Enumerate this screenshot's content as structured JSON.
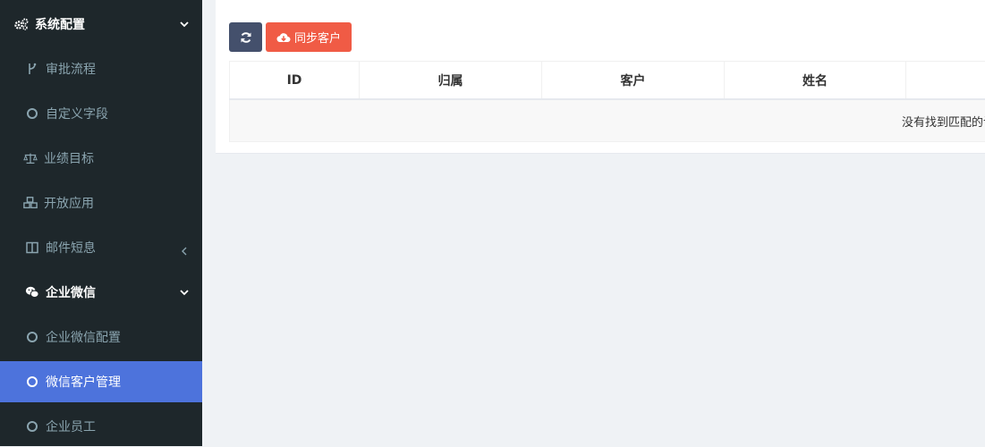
{
  "sidebar": {
    "items": [
      {
        "label": "系统配置",
        "icon": "gears-icon",
        "type": "group",
        "arrow": "chevron-down"
      },
      {
        "label": "审批流程",
        "icon": "fork-icon",
        "type": "child"
      },
      {
        "label": "自定义字段",
        "icon": "circle-icon",
        "type": "child"
      },
      {
        "label": "业绩目标",
        "icon": "scale-icon",
        "type": "child"
      },
      {
        "label": "开放应用",
        "icon": "cubes-icon",
        "type": "child"
      },
      {
        "label": "邮件短息",
        "icon": "columns-icon",
        "type": "child",
        "arrow": "chevron-left"
      },
      {
        "label": "企业微信",
        "icon": "wechat-icon",
        "type": "group",
        "arrow": "chevron-down"
      },
      {
        "label": "企业微信配置",
        "icon": "circle-icon",
        "type": "child"
      },
      {
        "label": "微信客户管理",
        "icon": "circle-icon",
        "type": "child",
        "active": true
      },
      {
        "label": "企业员工",
        "icon": "circle-icon",
        "type": "child"
      }
    ]
  },
  "toolbar": {
    "refresh_icon": "refresh-icon",
    "sync_icon": "cloud-download-icon",
    "sync_label": "同步客户"
  },
  "table": {
    "columns": [
      "ID",
      "归属",
      "客户",
      "姓名",
      ""
    ],
    "empty_text": "没有找到匹配的记录"
  },
  "colors": {
    "sidebar_bg": "#1e272b",
    "active_bg": "#4d73dc",
    "refresh_btn": "#44506c",
    "sync_btn": "#f05b45"
  }
}
